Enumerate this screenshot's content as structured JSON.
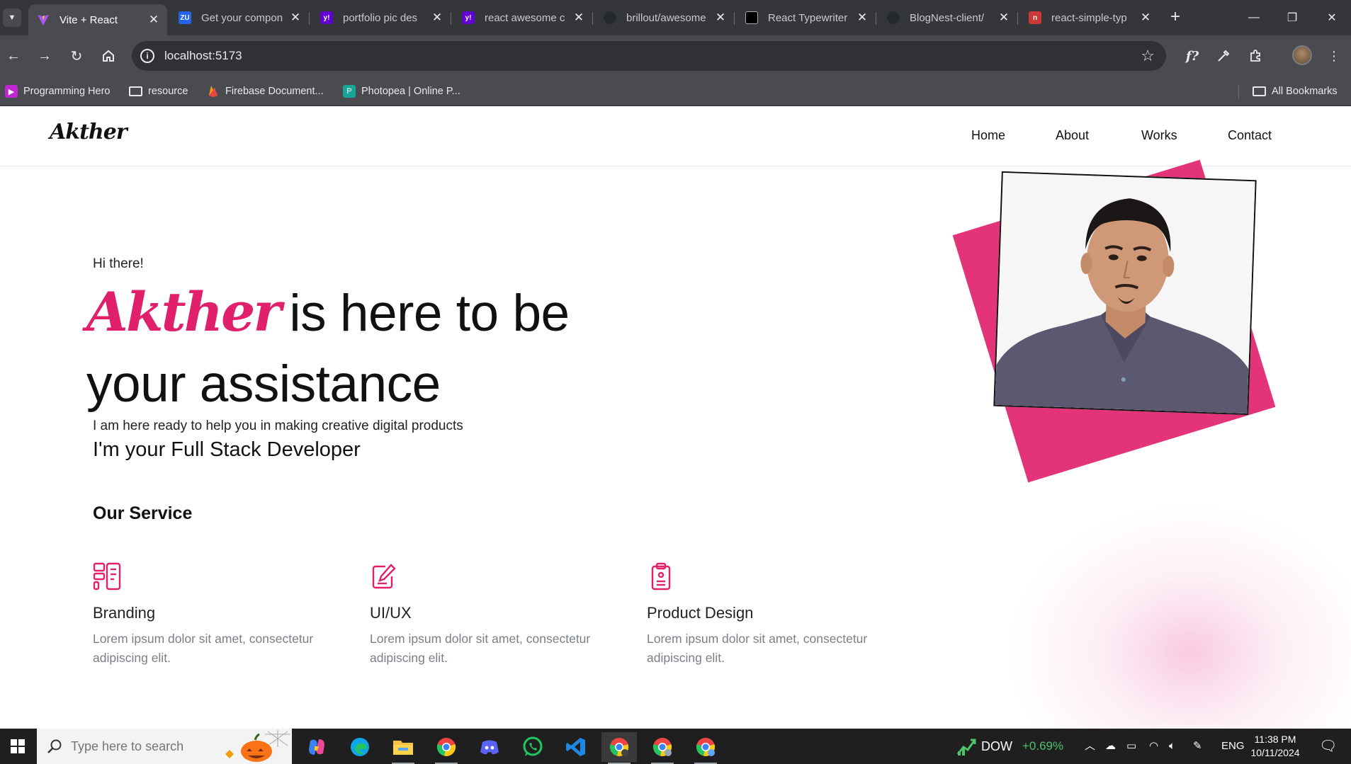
{
  "browser": {
    "tabs": [
      {
        "label": "Vite + React",
        "active": true,
        "favicon": "vite-icon",
        "favicon_color": "#a855f7"
      },
      {
        "label": "Get your compon",
        "active": false,
        "favicon": "zu-icon",
        "favicon_color": "#2563eb"
      },
      {
        "label": "portfolio pic des",
        "active": false,
        "favicon": "yahoo-icon",
        "favicon_color": "#6001d2"
      },
      {
        "label": "react awesome c",
        "active": false,
        "favicon": "yahoo-icon",
        "favicon_color": "#6001d2"
      },
      {
        "label": "brillout/awesome",
        "active": false,
        "favicon": "github-icon",
        "favicon_color": "#24292f"
      },
      {
        "label": "React Typewriter",
        "active": false,
        "favicon": "page-icon",
        "favicon_color": "#000000"
      },
      {
        "label": "BlogNest-client/",
        "active": false,
        "favicon": "github-icon",
        "favicon_color": "#24292f"
      },
      {
        "label": "react-simple-typ",
        "active": false,
        "favicon": "npm-icon",
        "favicon_color": "#cb3837"
      }
    ],
    "address": "localhost:5173",
    "bookmarks": [
      {
        "label": "Programming Hero",
        "icon": "programming-hero-icon",
        "color": "#c026d3"
      },
      {
        "label": "resource",
        "icon": "folder-icon"
      },
      {
        "label": "Firebase Document...",
        "icon": "firebase-icon",
        "color": "#f59e0b"
      },
      {
        "label": "Photopea | Online P...",
        "icon": "photopea-icon",
        "color": "#18a497"
      }
    ],
    "all_bookmarks": "All Bookmarks",
    "extensions": {
      "fx": "f?"
    }
  },
  "site": {
    "logo": "Akther",
    "nav": [
      "Home",
      "About",
      "Works",
      "Contact"
    ],
    "hero": {
      "greeting": "Hi there!",
      "name": "Akther",
      "headline_line1": "is here to be",
      "headline_line2": "your assistance",
      "tagline": "I am here ready to help you in making creative digital products",
      "role": "I'm your Full Stack Developer"
    },
    "services_title": "Our Service",
    "services": [
      {
        "title": "Branding",
        "desc": "Lorem ipsum dolor sit amet, consectetur adipiscing elit.",
        "icon": "branding-icon"
      },
      {
        "title": "UI/UX",
        "desc": "Lorem ipsum dolor sit amet, consectetur adipiscing elit.",
        "icon": "edit-icon"
      },
      {
        "title": "Product Design",
        "desc": "Lorem ipsum dolor sit amet, consectetur adipiscing elit.",
        "icon": "clipboard-icon"
      }
    ],
    "accent_color": "#e0206a"
  },
  "taskbar": {
    "search_placeholder": "Type here to search",
    "ticker": "DOW",
    "ticker_change": "+0.69%",
    "language": "ENG",
    "time": "11:38 PM",
    "date": "10/11/2024",
    "apps": [
      "copilot-icon",
      "edge-icon",
      "file-explorer-icon",
      "chrome-icon",
      "discord-icon",
      "whatsapp-icon",
      "vscode-icon",
      "chrome-icon",
      "chrome-icon",
      "chrome-icon"
    ]
  }
}
